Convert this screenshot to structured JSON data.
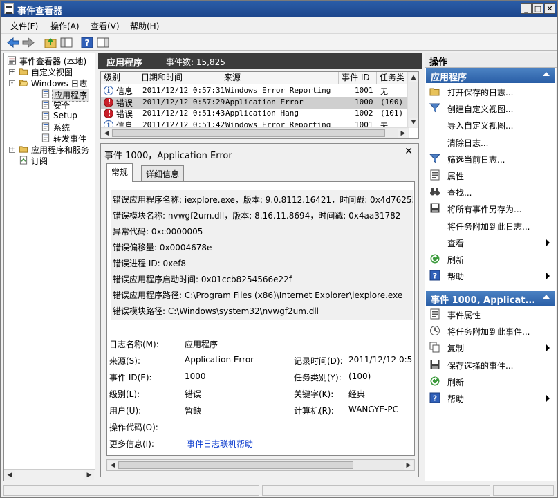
{
  "window": {
    "title": "事件查看器"
  },
  "menu": [
    "文件(F)",
    "操作(A)",
    "查看(V)",
    "帮助(H)"
  ],
  "tree": [
    {
      "label": "事件查看器 (本地)",
      "level": 0,
      "expander": "",
      "icon": "event-viewer-icon"
    },
    {
      "label": "自定义视图",
      "level": 1,
      "expander": "+",
      "icon": "folder-icon"
    },
    {
      "label": "Windows 日志",
      "level": 1,
      "expander": "-",
      "icon": "folder-open-icon"
    },
    {
      "label": "应用程序",
      "level": 2,
      "expander": "",
      "icon": "log-icon",
      "selected": true
    },
    {
      "label": "安全",
      "level": 2,
      "expander": "",
      "icon": "log-icon"
    },
    {
      "label": "Setup",
      "level": 2,
      "expander": "",
      "icon": "log-icon"
    },
    {
      "label": "系统",
      "level": 2,
      "expander": "",
      "icon": "log-icon"
    },
    {
      "label": "转发事件",
      "level": 2,
      "expander": "",
      "icon": "log-icon"
    },
    {
      "label": "应用程序和服务",
      "level": 1,
      "expander": "+",
      "icon": "folder-icon"
    },
    {
      "label": "订阅",
      "level": 1,
      "expander": "",
      "icon": "subscription-icon"
    }
  ],
  "center": {
    "title": "应用程序",
    "count_label": "事件数: 15,825"
  },
  "events": {
    "columns": [
      "级别",
      "日期和时间",
      "来源",
      "事件 ID",
      "任务类别"
    ],
    "rows": [
      {
        "level": "信息",
        "icon": "info-icon",
        "datetime": "2011/12/12 0:57:31",
        "source": "Windows Error Reporting",
        "id": "1001",
        "task": "无",
        "selected": false
      },
      {
        "level": "错误",
        "icon": "error-icon",
        "datetime": "2011/12/12 0:57:29",
        "source": "Application Error",
        "id": "1000",
        "task": "(100)",
        "selected": true
      },
      {
        "level": "错误",
        "icon": "error-icon",
        "datetime": "2011/12/12 0:51:43",
        "source": "Application Hang",
        "id": "1002",
        "task": "(101)",
        "selected": false
      },
      {
        "level": "信息",
        "icon": "info-icon",
        "datetime": "2011/12/12 0:51:42",
        "source": "Windows Error Reporting",
        "id": "1001",
        "task": "无",
        "selected": false
      }
    ]
  },
  "detail": {
    "title": "事件 1000，Application Error",
    "tabs": [
      "常规",
      "详细信息"
    ],
    "description": [
      "错误应用程序名称: iexplore.exe，版本: 9.0.8112.16421，时间戳: 0x4d76255d",
      "错误模块名称: nvwgf2um.dll，版本: 8.16.11.8694，时间戳: 0x4aa31782",
      "异常代码: 0xc0000005",
      "错误偏移量: 0x0004678e",
      "错误进程 ID: 0xef8",
      "错误应用程序启动时间: 0x01ccb8254566e22f",
      "错误应用程序路径: C:\\Program Files (x86)\\Internet Explorer\\iexplore.exe",
      "错误模块路径: C:\\Windows\\system32\\nvwgf2um.dll"
    ],
    "props": {
      "log_name_label": "日志名称(M):",
      "log_name": "应用程序",
      "source_label": "来源(S):",
      "source": "Application Error",
      "recorded_label": "记录时间(D):",
      "recorded": "2011/12/12 0:57",
      "event_id_label": "事件 ID(E):",
      "event_id": "1000",
      "task_label": "任务类别(Y):",
      "task": "(100)",
      "level_label": "级别(L):",
      "level": "错误",
      "keywords_label": "关键字(K):",
      "keywords": "经典",
      "user_label": "用户(U):",
      "user": "暂缺",
      "computer_label": "计算机(R):",
      "computer": "WANGYE-PC",
      "opcode_label": "操作代码(O):",
      "more_info_label": "更多信息(I):",
      "more_info_link": "事件日志联机帮助"
    }
  },
  "actions": {
    "header": "操作",
    "section1": {
      "title": "应用程序",
      "items": [
        {
          "label": "打开保存的日志...",
          "icon": "open-folder-icon",
          "submenu": false
        },
        {
          "label": "创建自定义视图...",
          "icon": "filter-icon",
          "submenu": false
        },
        {
          "label": "导入自定义视图...",
          "icon": "",
          "submenu": false
        },
        {
          "label": "清除日志...",
          "icon": "",
          "submenu": false
        },
        {
          "label": "筛选当前日志...",
          "icon": "filter-icon",
          "submenu": false
        },
        {
          "label": "属性",
          "icon": "properties-icon",
          "submenu": false
        },
        {
          "label": "查找...",
          "icon": "binoculars-icon",
          "submenu": false
        },
        {
          "label": "将所有事件另存为...",
          "icon": "save-icon",
          "submenu": false
        },
        {
          "label": "将任务附加到此日志...",
          "icon": "",
          "submenu": false
        },
        {
          "label": "查看",
          "icon": "",
          "submenu": true
        },
        {
          "label": "刷新",
          "icon": "refresh-icon",
          "submenu": false
        },
        {
          "label": "帮助",
          "icon": "help-icon",
          "submenu": true
        }
      ]
    },
    "section2": {
      "title": "事件 1000, Applicat...",
      "items": [
        {
          "label": "事件属性",
          "icon": "properties-icon",
          "submenu": false
        },
        {
          "label": "将任务附加到此事件...",
          "icon": "task-icon",
          "submenu": false
        },
        {
          "label": "复制",
          "icon": "copy-icon",
          "submenu": true
        },
        {
          "label": "保存选择的事件...",
          "icon": "save-icon",
          "submenu": false
        },
        {
          "label": "刷新",
          "icon": "refresh-icon",
          "submenu": false
        },
        {
          "label": "帮助",
          "icon": "help-icon",
          "submenu": true
        }
      ]
    }
  }
}
